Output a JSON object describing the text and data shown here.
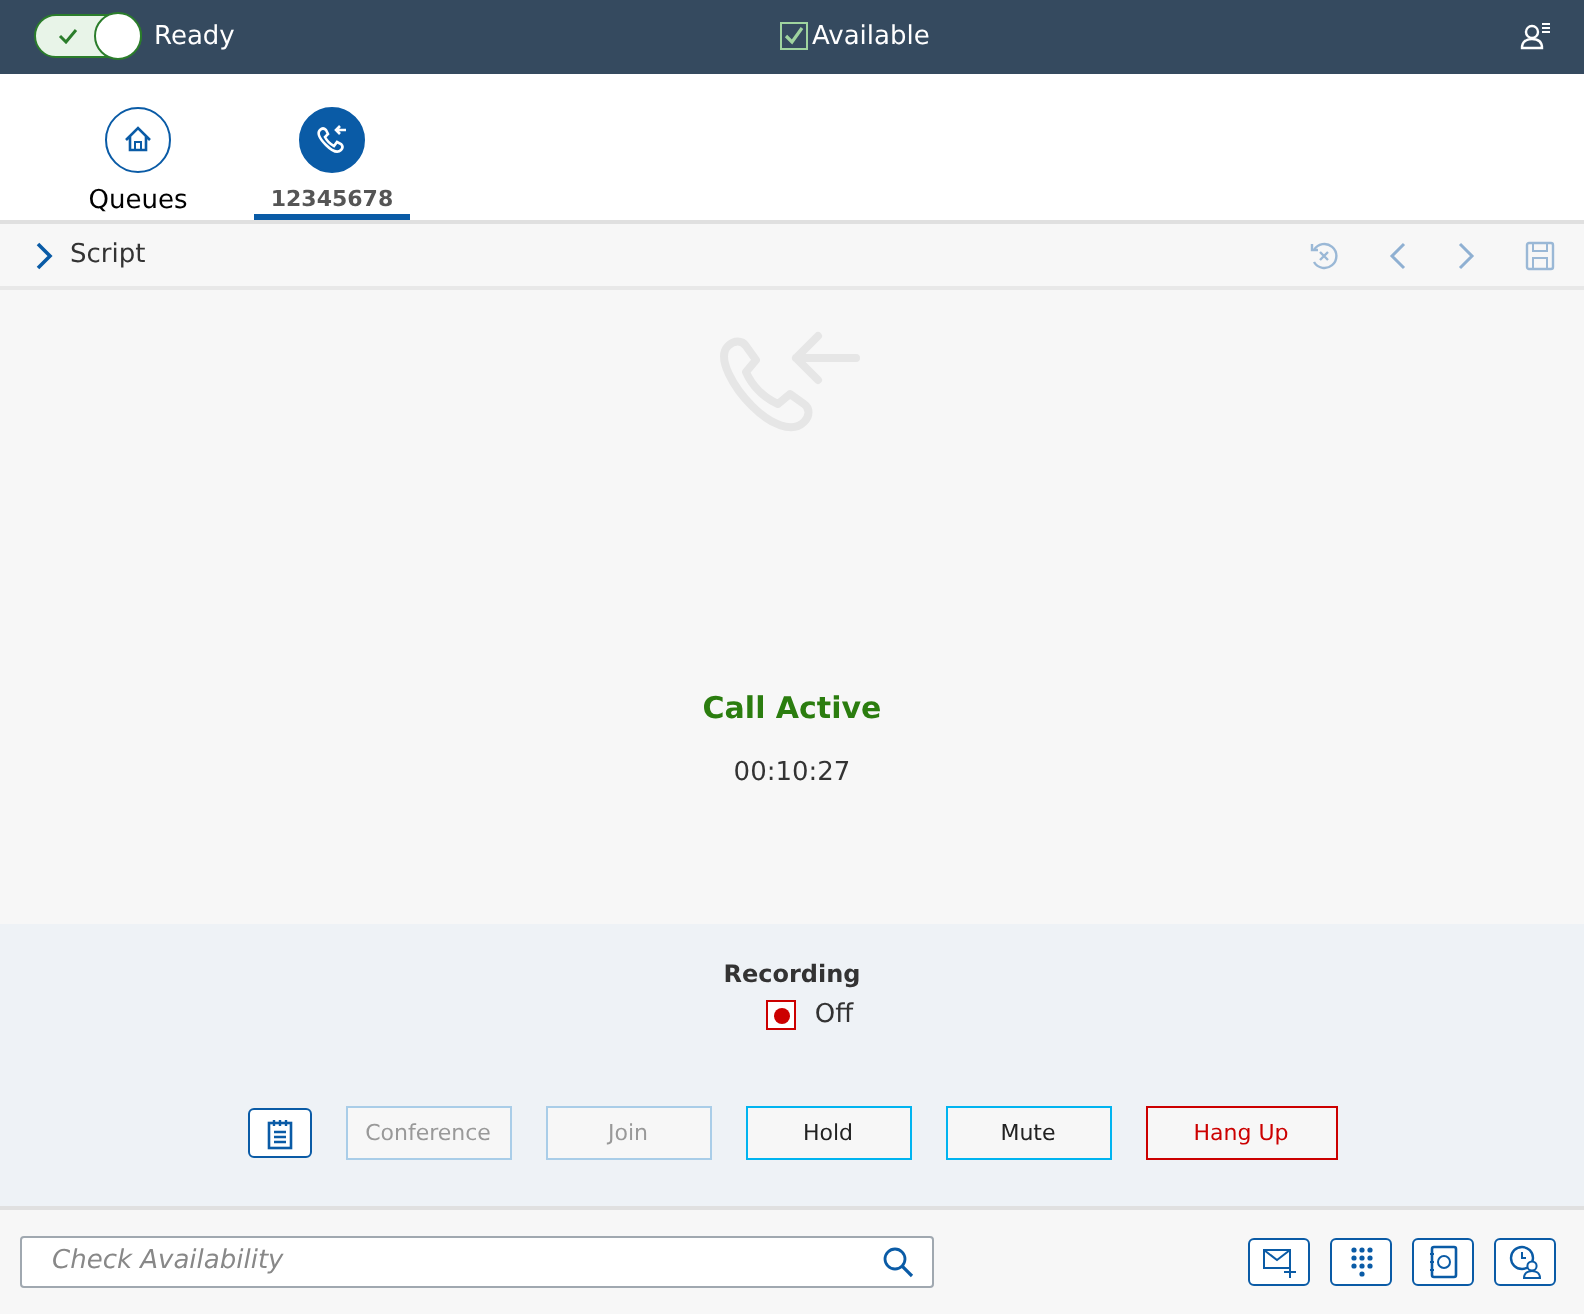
{
  "header": {
    "ready_toggle": {
      "on": true,
      "label": "Ready"
    },
    "available": {
      "checked": true,
      "label": "Available"
    }
  },
  "tabs": [
    {
      "label": "Queues",
      "kind": "home",
      "selected": false
    },
    {
      "label": "12345678",
      "kind": "call",
      "selected": true
    }
  ],
  "script_bar": {
    "label": "Script",
    "expanded": false
  },
  "call": {
    "status": "Call Active",
    "timer": "00:10:27"
  },
  "recording": {
    "title": "Recording",
    "on": false,
    "label": "Off"
  },
  "actions": [
    {
      "kind": "notes"
    },
    {
      "kind": "text",
      "label": "Conference",
      "disabled": true
    },
    {
      "kind": "text",
      "label": "Join",
      "disabled": true
    },
    {
      "kind": "text",
      "label": "Hold",
      "disabled": false
    },
    {
      "kind": "text",
      "label": "Mute",
      "disabled": false
    },
    {
      "kind": "danger",
      "label": "Hang Up"
    }
  ],
  "footer": {
    "search": {
      "placeholder": "Check Availability"
    }
  }
}
